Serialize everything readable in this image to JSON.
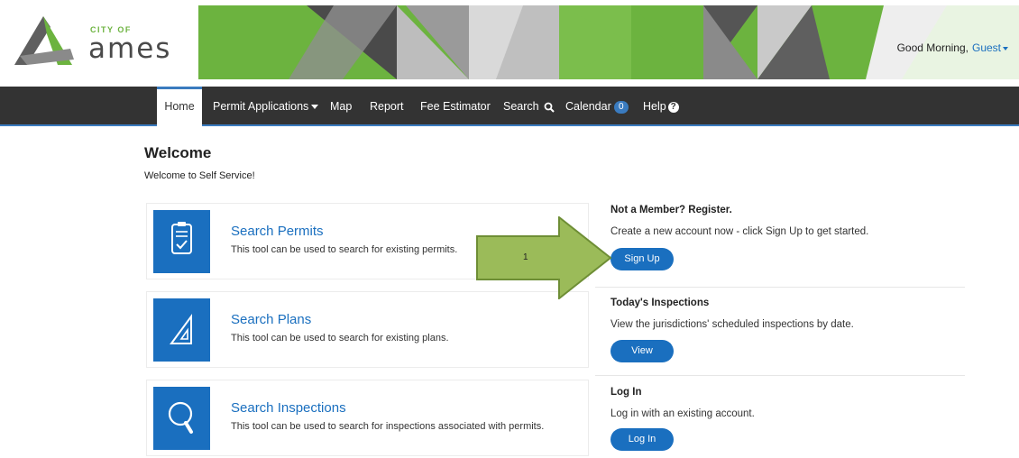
{
  "header": {
    "logo_city_of": "CITY OF",
    "logo_name": "ames",
    "greeting": "Good Morning,",
    "user": "Guest"
  },
  "nav": {
    "items": [
      {
        "label": "Home"
      },
      {
        "label": "Permit Applications"
      },
      {
        "label": "Map"
      },
      {
        "label": "Report"
      },
      {
        "label": "Fee Estimator"
      },
      {
        "label": "Search"
      },
      {
        "label": "Calendar",
        "badge": "0"
      },
      {
        "label": "Help"
      }
    ]
  },
  "main": {
    "title": "Welcome",
    "subtitle": "Welcome to Self Service!",
    "cards": [
      {
        "title": "Search Permits",
        "description": "This tool can be used to search for existing permits.",
        "icon": "clipboard-check-icon"
      },
      {
        "title": "Search Plans",
        "description": "This tool can be used to search for existing plans.",
        "icon": "triangle-ruler-icon"
      },
      {
        "title": "Search Inspections",
        "description": "This tool can be used to search for inspections associated with permits.",
        "icon": "magnifier-icon"
      }
    ]
  },
  "sidebar": {
    "register": {
      "heading": "Not a Member? Register.",
      "text": "Create a new account now - click Sign Up to get started.",
      "button": "Sign Up"
    },
    "inspections": {
      "heading": "Today's Inspections",
      "text": "View the jurisdictions' scheduled inspections by date.",
      "button": "View"
    },
    "login": {
      "heading": "Log In",
      "text": "Log in with an existing account.",
      "button": "Log In"
    }
  },
  "annotation": {
    "label": "1"
  },
  "colors": {
    "accent": "#1a6fbf",
    "nav_bg": "#333333",
    "brand_green": "#6cb33f",
    "arrow_green": "#9bbb59"
  }
}
